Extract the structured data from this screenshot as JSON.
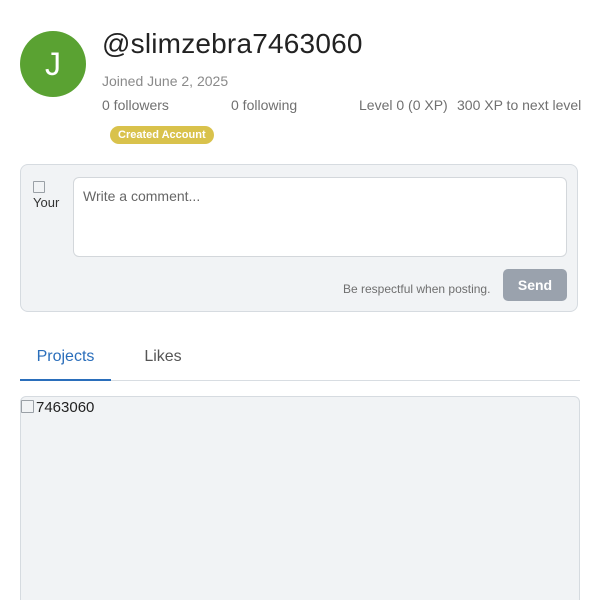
{
  "profile": {
    "avatar_letter": "J",
    "avatar_color": "#5aa232",
    "username": "@slimzebra7463060",
    "joined": "Joined June 2, 2025",
    "followers": "0 followers",
    "following": "0 following",
    "level": "Level 0 (0 XP)",
    "next_level": "300 XP to next level",
    "badge": "Created Account",
    "badge_color": "#d9c24c"
  },
  "comment": {
    "avatar_alt": "Your",
    "placeholder": "Write a comment...",
    "hint": "Be respectful when posting.",
    "send_label": "Send"
  },
  "tabs": [
    {
      "label": "Projects",
      "active": true
    },
    {
      "label": "Likes",
      "active": false
    }
  ],
  "projects": [
    {
      "thumbnail_alt": "7463060"
    }
  ],
  "colors": {
    "accent": "#2a6ebb",
    "send_button": "#9aa2ad",
    "card_background": "#f1f3f5"
  },
  "icons": {
    "broken_image": "broken-image-icon"
  }
}
